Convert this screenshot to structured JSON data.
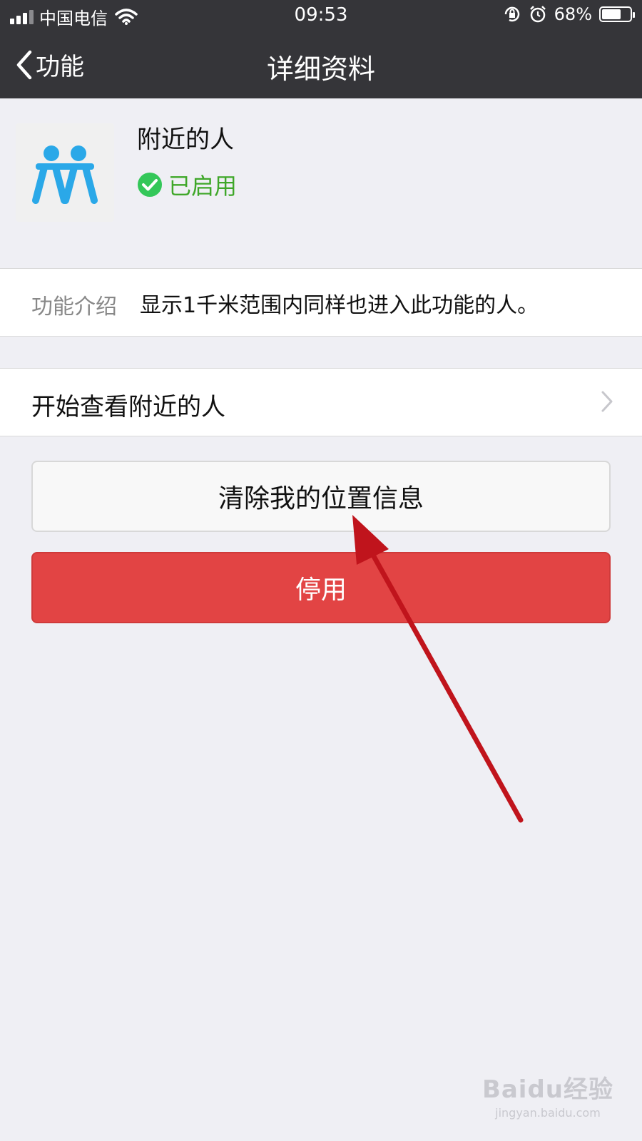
{
  "status_bar": {
    "carrier": "中国电信",
    "time": "09:53",
    "battery_percent": "68%",
    "battery_level": 0.68
  },
  "nav": {
    "back_label": "功能",
    "title": "详细资料"
  },
  "feature": {
    "name": "附近的人",
    "status_text": "已启用",
    "icon": "nearby-people-icon",
    "icon_color": "#2aa8e8",
    "status_color": "#3fa729"
  },
  "intro": {
    "label": "功能介绍",
    "text": "显示1千米范围内同样也进入此功能的人。"
  },
  "start_row": {
    "label": "开始查看附近的人"
  },
  "buttons": {
    "clear_location": "清除我的位置信息",
    "disable": "停用",
    "disable_color": "#e24444"
  },
  "watermark": {
    "brand": "Baidu经验",
    "url": "jingyan.baidu.com"
  }
}
